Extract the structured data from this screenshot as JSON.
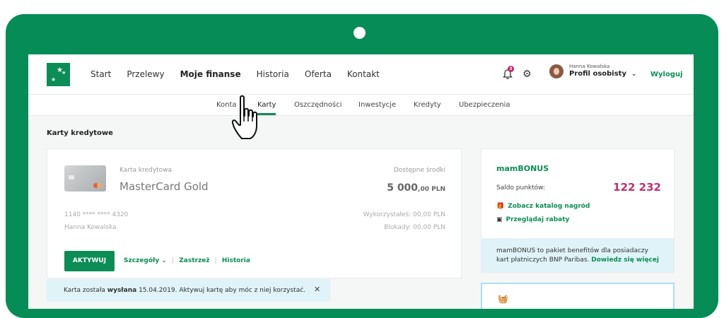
{
  "header": {
    "nav": [
      "Start",
      "Przelewy",
      "Moje finanse",
      "Historia",
      "Oferta",
      "Kontakt"
    ],
    "active_nav": "Moje finanse",
    "notifications_count": "3",
    "user_name": "Hanna Kowalska",
    "profile_label": "Profil osobisty",
    "logout_label": "Wyloguj"
  },
  "subnav": {
    "items": [
      "Konta",
      "Karty",
      "Oszczędności",
      "Inwestycje",
      "Kredyty",
      "Ubezpieczenia"
    ],
    "active": "Karty"
  },
  "page": {
    "section_title": "Karty kredytowe"
  },
  "card": {
    "type_label": "Karta kredytowa",
    "name": "MasterCard Gold",
    "available_label": "Dostępne środki",
    "available_main": "5 000",
    "available_decimal": ",00 PLN",
    "number": "1140 **** **** 4320",
    "holder": "Hanna Kowalska",
    "used": "Wykorzystałeś: 00,00 PLN",
    "blocked": "Blokady: 00,00 PLN",
    "activate_label": "AKTYWUJ",
    "details_label": "Szczegóły",
    "restrict_label": "Zastrzeż",
    "history_label": "Historia"
  },
  "notice": {
    "text_before": "Karta została ",
    "text_bold": "wysłana",
    "text_after": " 15.04.2019. Aktywuj kartę aby móc z niej korzystać."
  },
  "bonus": {
    "title_prefix": "mam",
    "title_suffix": "BONUS",
    "points_label": "Saldo punktów:",
    "points_value": "122 232",
    "catalog_link": "Zobacz katalog nagród",
    "discounts_link": "Przeglądaj rabaty",
    "info_text": "mamBONUS to pakiet benefitów dla posiadaczy kart płatniczych BNP Paribas.",
    "info_link": "Dowiedz się więcej"
  },
  "colors": {
    "brand_green": "#0b8d55",
    "device_green": "#068c57",
    "points_magenta": "#c2306e",
    "info_bg": "#dff3f8"
  }
}
